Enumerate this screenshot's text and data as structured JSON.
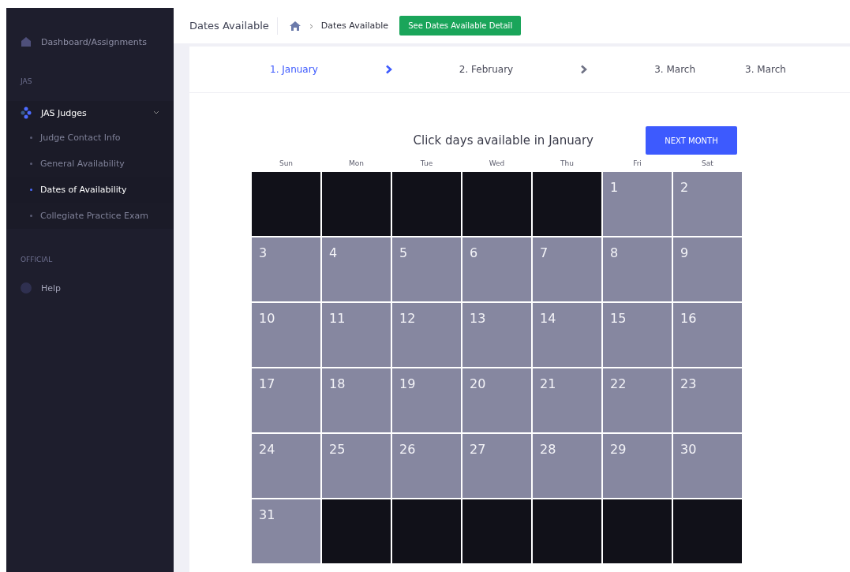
{
  "sidebar": {
    "top_item": {
      "label": "Dashboard/Assignments"
    },
    "sections": [
      {
        "heading": "JAS",
        "group": {
          "label": "JAS Judges",
          "expanded": true,
          "children": [
            {
              "label": "Judge Contact Info",
              "selected": false
            },
            {
              "label": "General Availability",
              "selected": false
            },
            {
              "label": "Dates of Availability",
              "selected": true
            },
            {
              "label": "Collegiate Practice Exam",
              "selected": false
            }
          ]
        }
      },
      {
        "heading": "OFFICIAL",
        "item": {
          "label": "Help"
        }
      }
    ]
  },
  "header": {
    "title": "Dates Available",
    "breadcrumb": "Dates Available",
    "button": "See Dates Available Detail"
  },
  "steps": [
    {
      "kind": "step",
      "label": "1. January",
      "selected": true
    },
    {
      "kind": "arrow",
      "selected": true
    },
    {
      "kind": "step",
      "label": "2. February",
      "selected": false
    },
    {
      "kind": "arrow",
      "selected": false
    },
    {
      "kind": "step",
      "label": "3. March",
      "selected": false
    },
    {
      "kind": "step",
      "label": "3. March",
      "selected": false
    }
  ],
  "calendar": {
    "title": "Click days available in January",
    "next_button": "NEXT MONTH",
    "weekdays": [
      "Sun",
      "Mon",
      "Tue",
      "Wed",
      "Thu",
      "Fri",
      "Sat"
    ],
    "weeks": [
      [
        {
          "kind": "empty"
        },
        {
          "kind": "empty"
        },
        {
          "kind": "empty"
        },
        {
          "kind": "empty"
        },
        {
          "kind": "empty"
        },
        {
          "kind": "day",
          "day": "1"
        },
        {
          "kind": "day",
          "day": "2"
        }
      ],
      [
        {
          "kind": "day",
          "day": "3"
        },
        {
          "kind": "day",
          "day": "4"
        },
        {
          "kind": "day",
          "day": "5"
        },
        {
          "kind": "day",
          "day": "6"
        },
        {
          "kind": "day",
          "day": "7"
        },
        {
          "kind": "day",
          "day": "8"
        },
        {
          "kind": "day",
          "day": "9"
        }
      ],
      [
        {
          "kind": "day",
          "day": "10"
        },
        {
          "kind": "day",
          "day": "11"
        },
        {
          "kind": "day",
          "day": "12"
        },
        {
          "kind": "day",
          "day": "13"
        },
        {
          "kind": "day",
          "day": "14"
        },
        {
          "kind": "day",
          "day": "15"
        },
        {
          "kind": "day",
          "day": "16"
        }
      ],
      [
        {
          "kind": "day",
          "day": "17"
        },
        {
          "kind": "day",
          "day": "18"
        },
        {
          "kind": "day",
          "day": "19"
        },
        {
          "kind": "day",
          "day": "20"
        },
        {
          "kind": "day",
          "day": "21"
        },
        {
          "kind": "day",
          "day": "22"
        },
        {
          "kind": "day",
          "day": "23"
        }
      ],
      [
        {
          "kind": "day",
          "day": "24"
        },
        {
          "kind": "day",
          "day": "25"
        },
        {
          "kind": "day",
          "day": "26"
        },
        {
          "kind": "day",
          "day": "27"
        },
        {
          "kind": "day",
          "day": "28"
        },
        {
          "kind": "day",
          "day": "29"
        },
        {
          "kind": "day",
          "day": "30"
        }
      ],
      [
        {
          "kind": "day",
          "day": "31"
        },
        {
          "kind": "empty"
        },
        {
          "kind": "empty"
        },
        {
          "kind": "empty"
        },
        {
          "kind": "empty"
        },
        {
          "kind": "empty"
        },
        {
          "kind": "empty"
        }
      ]
    ]
  }
}
